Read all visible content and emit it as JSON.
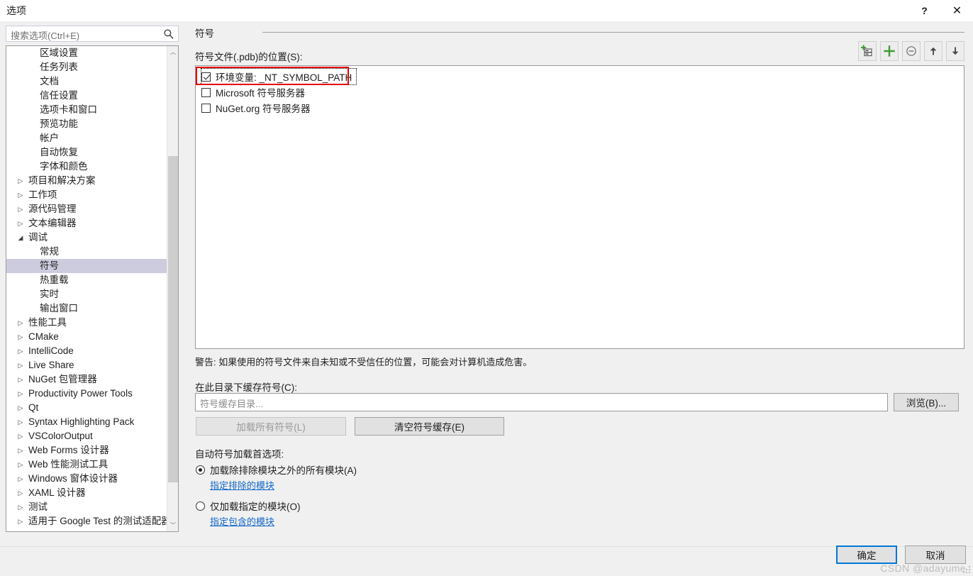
{
  "window": {
    "title": "选项",
    "help_label": "?",
    "close_label": "✕"
  },
  "search": {
    "placeholder": "搜索选项(Ctrl+E)",
    "icon": "search-icon"
  },
  "tree": {
    "items": [
      {
        "label": "区域设置",
        "level": 1,
        "arrow": "",
        "selected": false
      },
      {
        "label": "任务列表",
        "level": 1,
        "arrow": "",
        "selected": false
      },
      {
        "label": "文档",
        "level": 1,
        "arrow": "",
        "selected": false
      },
      {
        "label": "信任设置",
        "level": 1,
        "arrow": "",
        "selected": false
      },
      {
        "label": "选项卡和窗口",
        "level": 1,
        "arrow": "",
        "selected": false
      },
      {
        "label": "预览功能",
        "level": 1,
        "arrow": "",
        "selected": false
      },
      {
        "label": "帐户",
        "level": 1,
        "arrow": "",
        "selected": false
      },
      {
        "label": "自动恢复",
        "level": 1,
        "arrow": "",
        "selected": false
      },
      {
        "label": "字体和颜色",
        "level": 1,
        "arrow": "",
        "selected": false
      },
      {
        "label": "项目和解决方案",
        "level": 0,
        "arrow": "▷",
        "selected": false
      },
      {
        "label": "工作项",
        "level": 0,
        "arrow": "▷",
        "selected": false
      },
      {
        "label": "源代码管理",
        "level": 0,
        "arrow": "▷",
        "selected": false
      },
      {
        "label": "文本编辑器",
        "level": 0,
        "arrow": "▷",
        "selected": false
      },
      {
        "label": "调试",
        "level": 0,
        "arrow": "◢",
        "selected": false
      },
      {
        "label": "常规",
        "level": 1,
        "arrow": "",
        "selected": false
      },
      {
        "label": "符号",
        "level": 1,
        "arrow": "",
        "selected": true
      },
      {
        "label": "热重载",
        "level": 1,
        "arrow": "",
        "selected": false
      },
      {
        "label": "实时",
        "level": 1,
        "arrow": "",
        "selected": false
      },
      {
        "label": "输出窗口",
        "level": 1,
        "arrow": "",
        "selected": false
      },
      {
        "label": "性能工具",
        "level": 0,
        "arrow": "▷",
        "selected": false
      },
      {
        "label": "CMake",
        "level": 0,
        "arrow": "▷",
        "selected": false
      },
      {
        "label": "IntelliCode",
        "level": 0,
        "arrow": "▷",
        "selected": false
      },
      {
        "label": "Live Share",
        "level": 0,
        "arrow": "▷",
        "selected": false
      },
      {
        "label": "NuGet 包管理器",
        "level": 0,
        "arrow": "▷",
        "selected": false
      },
      {
        "label": "Productivity Power Tools",
        "level": 0,
        "arrow": "▷",
        "selected": false
      },
      {
        "label": "Qt",
        "level": 0,
        "arrow": "▷",
        "selected": false
      },
      {
        "label": "Syntax Highlighting Pack",
        "level": 0,
        "arrow": "▷",
        "selected": false
      },
      {
        "label": "VSColorOutput",
        "level": 0,
        "arrow": "▷",
        "selected": false
      },
      {
        "label": "Web Forms 设计器",
        "level": 0,
        "arrow": "▷",
        "selected": false
      },
      {
        "label": "Web 性能测试工具",
        "level": 0,
        "arrow": "▷",
        "selected": false
      },
      {
        "label": "Windows 窗体设计器",
        "level": 0,
        "arrow": "▷",
        "selected": false
      },
      {
        "label": "XAML 设计器",
        "level": 0,
        "arrow": "▷",
        "selected": false
      },
      {
        "label": "测试",
        "level": 0,
        "arrow": "▷",
        "selected": false
      },
      {
        "label": "适用于 Google Test 的测试适配器",
        "level": 0,
        "arrow": "▷",
        "selected": false
      }
    ],
    "scroll_up_arrow": "︿",
    "scroll_down_arrow": "﹀"
  },
  "pane": {
    "header": "符号",
    "symbol_files_label": "符号文件(.pdb)的位置(S):",
    "toolbar": [
      {
        "name": "new-symbol-server-icon",
        "title": "新建符号服务器位置"
      },
      {
        "name": "add-icon",
        "title": "新位置"
      },
      {
        "name": "remove-icon",
        "title": "删除"
      },
      {
        "name": "move-up-icon",
        "title": "上移"
      },
      {
        "name": "move-down-icon",
        "title": "下移"
      }
    ],
    "symbol_locations": [
      {
        "label": "环境变量: _NT_SYMBOL_PATH",
        "checked": true,
        "focused": true
      },
      {
        "label": "Microsoft 符号服务器",
        "checked": false,
        "focused": false
      },
      {
        "label": "NuGet.org 符号服务器",
        "checked": false,
        "focused": false
      }
    ],
    "warning": "警告: 如果使用的符号文件来自未知或不受信任的位置，可能会对计算机造成危害。",
    "cache_label": "在此目录下缓存符号(C):",
    "cache_placeholder": "符号缓存目录...",
    "browse_button": "浏览(B)...",
    "load_all_button": "加载所有符号(L)",
    "clear_cache_button": "清空符号缓存(E)",
    "autoload_label": "自动符号加载首选项:",
    "radio_all": "加载除排除模块之外的所有模块(A)",
    "link_excluded": "指定排除的模块",
    "radio_specified": "仅加载指定的模块(O)",
    "link_included": "指定包含的模块"
  },
  "footer": {
    "ok_button": "确定",
    "cancel_button": "取消"
  },
  "watermark": "CSDN @adayume",
  "colors": {
    "accent": "#0078d7",
    "link": "#1267c8",
    "selection": "#cdccdf",
    "highlight_box": "#e40000",
    "toolbar_green": "#3f9c35"
  }
}
